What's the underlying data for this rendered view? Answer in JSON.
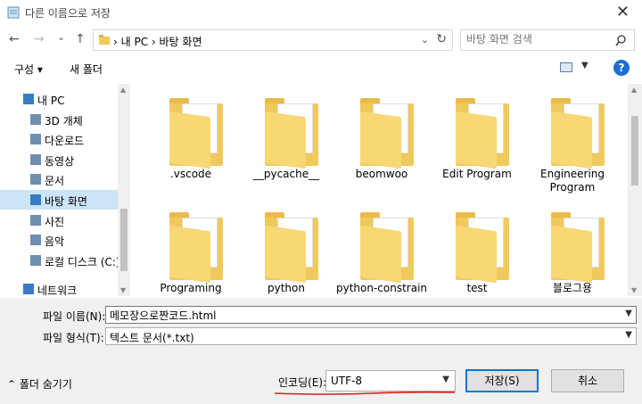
{
  "window": {
    "title": "다른 이름으로 저장",
    "close_glyph": "✕"
  },
  "address": {
    "back_glyph": "←",
    "forward_glyph": "→",
    "recent_glyph": "⌄",
    "up_glyph": "↑",
    "crumbs": "› 내 PC  ›  바탕 화면",
    "dropdown_glyph": "⌄",
    "refresh_glyph": "↻"
  },
  "search": {
    "placeholder": "바탕 화면 검색",
    "icon": "search-icon"
  },
  "toolbar": {
    "organize": "구성 ▾",
    "new_folder": "새 폴더",
    "view_dd": "▼",
    "help": "?"
  },
  "nav": [
    {
      "label": "내 PC",
      "icon": "pc-icon",
      "indent": 1
    },
    {
      "label": "3D 개체",
      "icon": "3d-objects-icon",
      "indent": 2
    },
    {
      "label": "다운로드",
      "icon": "downloads-icon",
      "indent": 2
    },
    {
      "label": "동영상",
      "icon": "videos-icon",
      "indent": 2
    },
    {
      "label": "문서",
      "icon": "documents-icon",
      "indent": 2
    },
    {
      "label": "바탕 화면",
      "icon": "desktop-icon",
      "indent": 2,
      "selected": true
    },
    {
      "label": "사진",
      "icon": "pictures-icon",
      "indent": 2
    },
    {
      "label": "음악",
      "icon": "music-icon",
      "indent": 2
    },
    {
      "label": "로컬 디스크 (C:)",
      "icon": "disk-icon",
      "indent": 2
    },
    {
      "label": "네트워크",
      "icon": "network-icon",
      "indent": 1
    }
  ],
  "files": [
    {
      "name": ".vscode",
      "icon": "folder-icon"
    },
    {
      "name": "__pycache__",
      "icon": "folder-icon"
    },
    {
      "name": "beomwoo",
      "icon": "folder-icon"
    },
    {
      "name": "Edit Program",
      "icon": "folder-icon"
    },
    {
      "name": "Engineering\nProgram",
      "icon": "folder-icon"
    },
    {
      "name": "Programing",
      "icon": "folder-icon"
    },
    {
      "name": "python",
      "icon": "folder-icon"
    },
    {
      "name": "python-constrain",
      "icon": "folder-icon"
    },
    {
      "name": "test",
      "icon": "folder-icon"
    },
    {
      "name": "블로그용",
      "icon": "folder-icon"
    }
  ],
  "form": {
    "filename_label": "파일 이름(N):",
    "filename_value": "메모장으로짠코드.html",
    "filetype_label": "파일 형식(T):",
    "filetype_value": "텍스트 문서(*.txt)",
    "hide_folders": "⌃  폴더 숨기기",
    "encoding_label": "인코딩(E):",
    "encoding_value": "UTF-8",
    "save": "저장(S)",
    "cancel": "취소"
  },
  "colors": {
    "folder": "#f0c95c",
    "selection": "#cce4f7",
    "accent": "#0078d7",
    "annotation": "#d61f1f"
  }
}
